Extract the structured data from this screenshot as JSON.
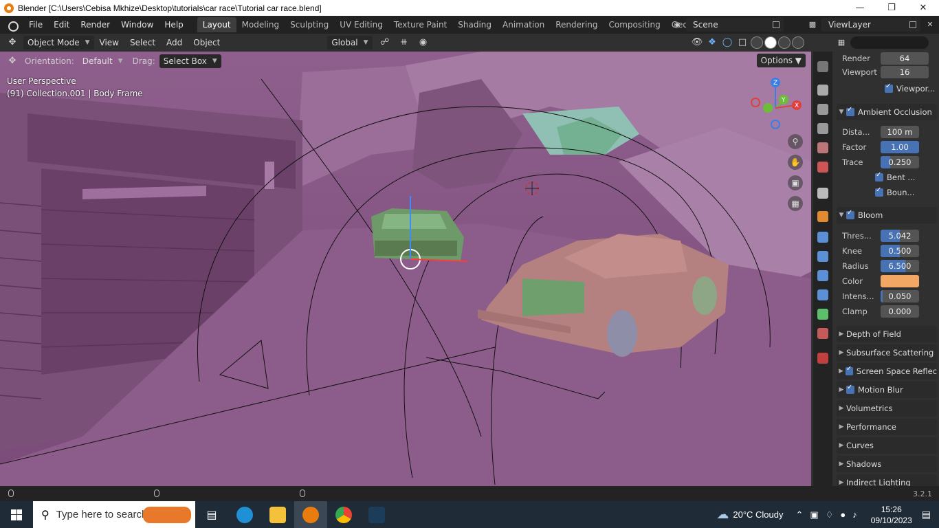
{
  "window": {
    "title": "Blender [C:\\Users\\Cebisa Mkhize\\Desktop\\tutorials\\car race\\Tutorial car race.blend]"
  },
  "menu": {
    "items": [
      "File",
      "Edit",
      "Render",
      "Window",
      "Help"
    ]
  },
  "workspaces": {
    "tabs": [
      "Layout",
      "Modeling",
      "Sculpting",
      "UV Editing",
      "Texture Paint",
      "Shading",
      "Animation",
      "Rendering",
      "Compositing",
      "Geometry Noc"
    ],
    "active": "Layout"
  },
  "scene": {
    "name": "Scene"
  },
  "viewlayer": {
    "name": "ViewLayer"
  },
  "viewport_header": {
    "mode": "Object Mode",
    "menus": [
      "View",
      "Select",
      "Add",
      "Object"
    ],
    "transform": "Global"
  },
  "tool_header": {
    "orientation_label": "Orientation:",
    "orientation_value": "Default",
    "drag_label": "Drag:",
    "drag_value": "Select Box",
    "options": "Options"
  },
  "viewport": {
    "perspective": "User Perspective",
    "collection": "(91) Collection.001 | Body Frame",
    "gizmo_axes": [
      "Z",
      "Y",
      "X"
    ]
  },
  "properties": {
    "render_label": "Render",
    "render_value": "64",
    "viewport_label": "Viewport",
    "viewport_value": "16",
    "viewport_denoise": "Viewpor...",
    "ambient_occlusion": "Ambient Occlusion",
    "distance_label": "Dista...",
    "distance_value": "100 m",
    "factor_label": "Factor",
    "factor_value": "1.00",
    "trace_label": "Trace",
    "trace_value": "0.250",
    "bent_normals": "Bent ...",
    "bounces": "Boun...",
    "bloom": "Bloom",
    "threshold_label": "Thres...",
    "threshold_value": "5.042",
    "knee_label": "Knee",
    "knee_value": "0.500",
    "radius_label": "Radius",
    "radius_value": "6.500",
    "color_label": "Color",
    "color_hex": "#f2a765",
    "intensity_label": "Intens...",
    "intensity_value": "0.050",
    "clamp_label": "Clamp",
    "clamp_value": "0.000",
    "panels": [
      {
        "label": "Depth of Field",
        "checkbox": false
      },
      {
        "label": "Subsurface Scattering",
        "checkbox": false
      },
      {
        "label": "Screen Space Reflec",
        "checkbox": true
      },
      {
        "label": "Motion Blur",
        "checkbox": true
      },
      {
        "label": "Volumetrics",
        "checkbox": false
      },
      {
        "label": "Performance",
        "checkbox": false
      },
      {
        "label": "Curves",
        "checkbox": false
      },
      {
        "label": "Shadows",
        "checkbox": false
      },
      {
        "label": "Indirect Lighting",
        "checkbox": false
      }
    ]
  },
  "status": {
    "version": "3.2.1"
  },
  "taskbar": {
    "search_placeholder": "Type here to search",
    "weather": "20°C  Cloudy",
    "time": "15:26",
    "date": "09/10/2023"
  }
}
